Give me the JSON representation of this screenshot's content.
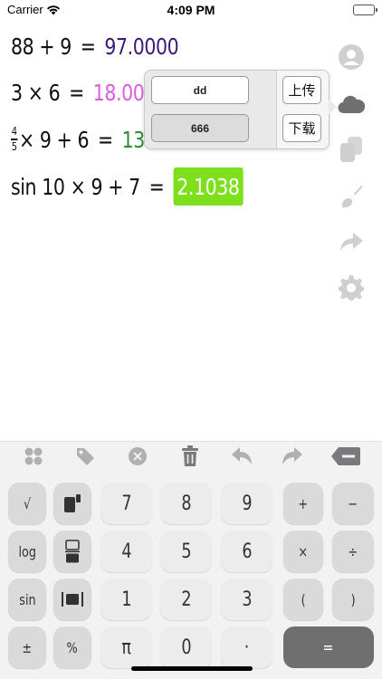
{
  "status_bar": {
    "carrier": "Carrier",
    "time": "4:09 PM"
  },
  "expressions": [
    {
      "expression": "88 + 9",
      "equals": "=",
      "result": "97.0000",
      "result_color": "#3b1a78"
    },
    {
      "expression": "3 × 6",
      "equals": "=",
      "result": "18.000",
      "result_color": "#d95fe0"
    },
    {
      "fraction_numerator": "4",
      "fraction_denominator": "5",
      "expression": "× 9 + 6",
      "equals": "=",
      "result": "13",
      "result_color": "#2e8a3a"
    },
    {
      "expression": "sin 10 × 9 + 7",
      "equals": "=",
      "result": "2.1038",
      "result_color": "#ffffff",
      "result_background": "#7ee01c"
    }
  ],
  "cloud_popup": {
    "field_1": "dd",
    "field_2": "666",
    "upload_label": "上传",
    "download_label": "下载"
  },
  "sidebar": {
    "icons": [
      "profile-icon",
      "cloud-icon",
      "copy-icon",
      "brush-icon",
      "share-icon",
      "settings-icon"
    ]
  },
  "keyboard": {
    "toolbar": [
      "palette-icon",
      "tag-icon",
      "clear-icon",
      "trash-icon",
      "undo-icon",
      "redo-icon",
      "backspace-icon"
    ],
    "keys": {
      "sqrt": "√",
      "seven": "7",
      "eight": "8",
      "nine": "9",
      "plus": "+",
      "minus": "−",
      "log": "log",
      "four": "4",
      "five": "5",
      "six": "6",
      "multiply": "×",
      "divide": "÷",
      "sin": "sin",
      "one": "1",
      "two": "2",
      "three": "3",
      "open_paren": "(",
      "close_paren": ")",
      "plus_minus": "±",
      "percent": "%",
      "pi": "π",
      "zero": "0",
      "dot": "·",
      "equals": "="
    }
  },
  "colors": {
    "accent_green": "#7ee01c",
    "sidebar_icon": "#cfcfd1",
    "keyboard_bg": "#f2f2f3"
  }
}
